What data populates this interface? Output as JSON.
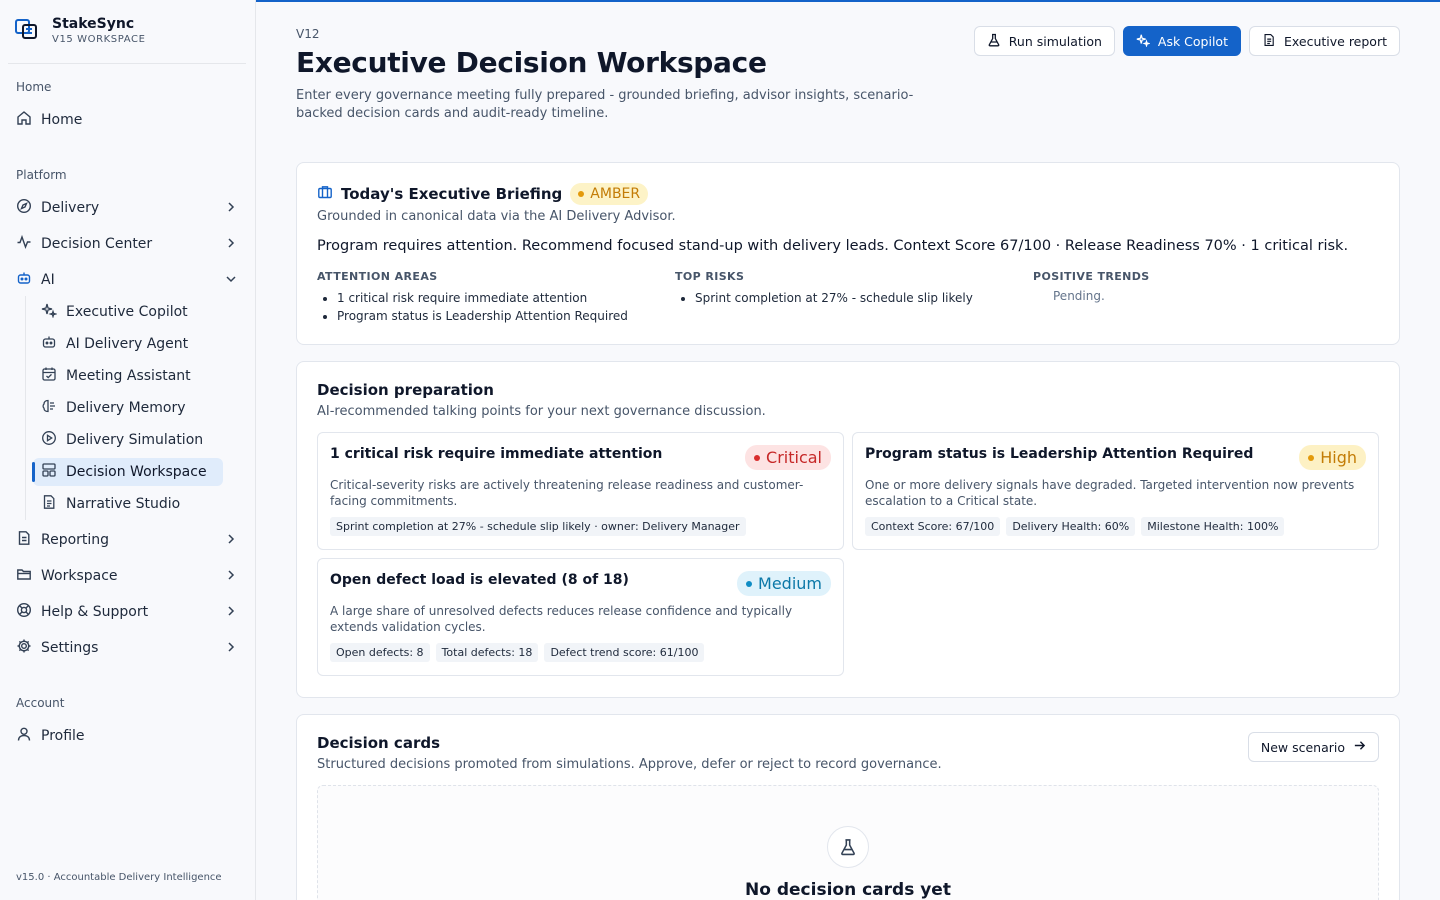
{
  "brand": {
    "name": "StakeSync",
    "sub": "V15 WORKSPACE"
  },
  "sidebar": {
    "sections": {
      "home": "Home",
      "platform": "Platform",
      "account": "Account"
    },
    "home_item": "Home",
    "platform_items": [
      {
        "label": "Delivery",
        "icon": "compass-icon"
      },
      {
        "label": "Decision Center",
        "icon": "activity-icon"
      },
      {
        "label": "AI",
        "icon": "bot-icon"
      }
    ],
    "ai_items": [
      {
        "label": "Executive Copilot",
        "icon": "sparkles-icon"
      },
      {
        "label": "AI Delivery Agent",
        "icon": "bot-icon"
      },
      {
        "label": "Meeting Assistant",
        "icon": "calendar-check-icon"
      },
      {
        "label": "Delivery Memory",
        "icon": "brain-icon"
      },
      {
        "label": "Delivery Simulation",
        "icon": "play-circle-icon"
      },
      {
        "label": "Decision Workspace",
        "icon": "layout-icon"
      },
      {
        "label": "Narrative Studio",
        "icon": "file-text-icon"
      }
    ],
    "more_items": [
      {
        "label": "Reporting",
        "icon": "file-icon"
      },
      {
        "label": "Workspace",
        "icon": "folder-icon"
      },
      {
        "label": "Help & Support",
        "icon": "lifebuoy-icon"
      },
      {
        "label": "Settings",
        "icon": "gear-icon"
      }
    ],
    "profile": "Profile",
    "footer": "v15.0 · Accountable Delivery Intelligence"
  },
  "header": {
    "version": "V12",
    "title": "Executive Decision Workspace",
    "subtitle": "Enter every governance meeting fully prepared - grounded briefing, advisor insights, scenario-backed decision cards and audit-ready timeline.",
    "actions": {
      "run_simulation": "Run simulation",
      "ask_copilot": "Ask Copilot",
      "executive_report": "Executive report"
    }
  },
  "briefing": {
    "title": "Today's Executive Briefing",
    "status": "AMBER",
    "subtitle": "Grounded in canonical data via the AI Delivery Advisor.",
    "summary": "Program requires attention. Recommend focused stand-up with delivery leads. Context Score 67/100 · Release Readiness 70% · 1 critical risk.",
    "attention_head": "ATTENTION AREAS",
    "attention": [
      "1 critical risk require immediate attention",
      "Program status is Leadership Attention Required"
    ],
    "risks_head": "TOP RISKS",
    "risks": [
      "Sprint completion at 27% - schedule slip likely"
    ],
    "trends_head": "POSITIVE TRENDS",
    "trends_pending": "Pending."
  },
  "prep": {
    "title": "Decision preparation",
    "subtitle": "AI-recommended talking points for your next governance discussion.",
    "cards": [
      {
        "title": "1 critical risk require immediate attention",
        "severity": "Critical",
        "desc": "Critical-severity risks are actively threatening release readiness and customer-facing commitments.",
        "chips": [
          "Sprint completion at 27% - schedule slip likely · owner: Delivery Manager"
        ]
      },
      {
        "title": "Program status is Leadership Attention Required",
        "severity": "High",
        "desc": "One or more delivery signals have degraded. Targeted intervention now prevents escalation to a Critical state.",
        "chips": [
          "Context Score: 67/100",
          "Delivery Health: 60%",
          "Milestone Health: 100%"
        ]
      },
      {
        "title": "Open defect load is elevated (8 of 18)",
        "severity": "Medium",
        "desc": "A large share of unresolved defects reduces release confidence and typically extends validation cycles.",
        "chips": [
          "Open defects: 8",
          "Total defects: 18",
          "Defect trend score: 61/100"
        ]
      }
    ]
  },
  "decision_cards": {
    "title": "Decision cards",
    "subtitle": "Structured decisions promoted from simulations. Approve, defer or reject to record governance.",
    "new_scenario": "New scenario",
    "empty_title": "No decision cards yet"
  },
  "colors": {
    "accent": "#1463c9",
    "amber": "#c37c06",
    "critical": "#c62828",
    "medium": "#0b78a8"
  }
}
